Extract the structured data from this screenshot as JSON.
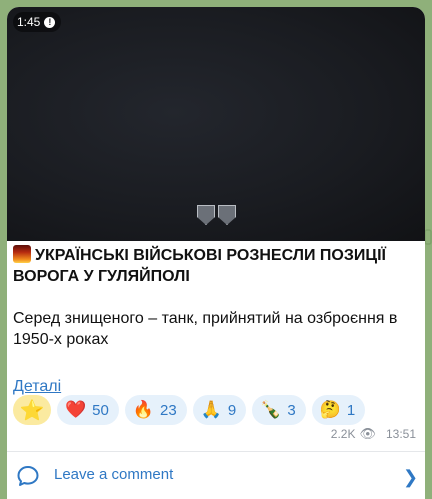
{
  "video": {
    "duration": "1:45",
    "mute_badge": "!"
  },
  "post": {
    "title": "УКРАЇНСЬКІ ВІЙСЬКОВІ РОЗНЕСЛИ ПОЗИЦІЇ ВОРОГА У ГУЛЯЙПОЛІ",
    "title_icon": "fire-emoji",
    "body": "Серед знищеного – танк, прийнятий на озброєння в 1950-х роках",
    "link": "Деталі"
  },
  "reactions": [
    {
      "icon": "star-icon",
      "emoji": "⭐",
      "count": ""
    },
    {
      "icon": "heart-emoji",
      "emoji": "❤️",
      "count": "50"
    },
    {
      "icon": "fire-emoji",
      "emoji": "🔥",
      "count": "23"
    },
    {
      "icon": "pray-emoji",
      "emoji": "🙏",
      "count": "9"
    },
    {
      "icon": "champagne-emoji",
      "emoji": "🍾",
      "count": "3"
    },
    {
      "icon": "thinking-emoji",
      "emoji": "🤔",
      "count": "1"
    }
  ],
  "meta": {
    "views": "2.2K",
    "time": "13:51"
  },
  "comment": {
    "label": "Leave a comment"
  },
  "colors": {
    "accent": "#2f78c4",
    "chip_bg": "#e6f1fb",
    "star_chip_bg": "#fbeaa0",
    "background": "#8fb07a"
  }
}
